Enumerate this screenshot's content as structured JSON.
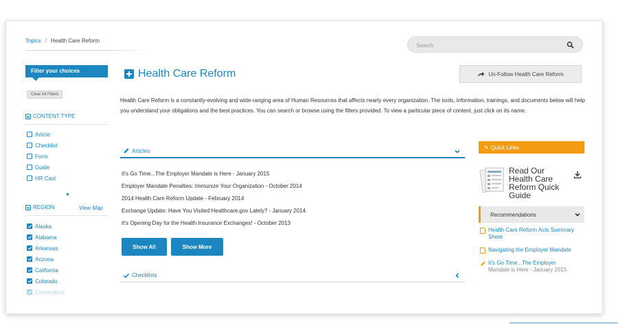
{
  "breadcrumb": {
    "root": "Topics",
    "separator": "/",
    "current": "Health Care Reform"
  },
  "search": {
    "placeholder": "Search"
  },
  "sidebar": {
    "filter_title": "Filter your choices",
    "clear_label": "Clear All Filters",
    "content_type": {
      "title": "CONTENT TYPE",
      "items": [
        {
          "label": "Article",
          "checked": false
        },
        {
          "label": "Checklist",
          "checked": false
        },
        {
          "label": "Form",
          "checked": false
        },
        {
          "label": "Guide",
          "checked": false
        },
        {
          "label": "HR Cast",
          "checked": false
        }
      ]
    },
    "region": {
      "title": "REGION",
      "view_map": "View Map",
      "items": [
        {
          "label": "Alaska",
          "checked": true
        },
        {
          "label": "Alabama",
          "checked": true
        },
        {
          "label": "Arkansas",
          "checked": true
        },
        {
          "label": "Arizona",
          "checked": true
        },
        {
          "label": "California",
          "checked": true
        },
        {
          "label": "Colorado",
          "checked": true
        },
        {
          "label": "Connecticut",
          "checked": true
        }
      ]
    }
  },
  "main": {
    "title": "Health Care Reform",
    "unfollow_label": "Un-Follow Health Care Reform",
    "intro": "Health Care Reform is a constantly-evolving and wide-ranging area of Human Resources that affects nearly every organization. The tools, information, trainings, and documents below will help you understand your obligations and the best practices. You can search or browse using the filters provided. To view a particular piece of content, just click on its name.",
    "articles_label": "Articles",
    "articles": [
      "It's Go Time...The Employer Mandate is Here - January 2015",
      "Employer Mandate Penalties: Immunize Your Organization - October 2014",
      "2014 Health Care Reform Update - February 2014",
      "Exchange Update: Have You Visited Healthcare.gov Lately? - January 2014",
      "It's Opening Day for the Health Insurance Exchanges! - October 2013"
    ],
    "show_all": "Show All",
    "show_more": "Show More",
    "checklists_label": "Checklists"
  },
  "quick_links": {
    "title": "Quick Links",
    "guide_title": "Read Our Health Care Reform Quick Guide",
    "recommendations_title": "Recommendations",
    "recommendations": [
      {
        "title": "Health Care Reform Acts Summary Sheet",
        "sub": ""
      },
      {
        "title": "Navigating the Employer Mandate",
        "sub": ""
      },
      {
        "title": "It's Go Time...The Employer",
        "sub": "Mandate is Here - January 2015"
      }
    ]
  },
  "colors": {
    "accent": "#1b86c0",
    "quick_links": "#f39c12"
  }
}
